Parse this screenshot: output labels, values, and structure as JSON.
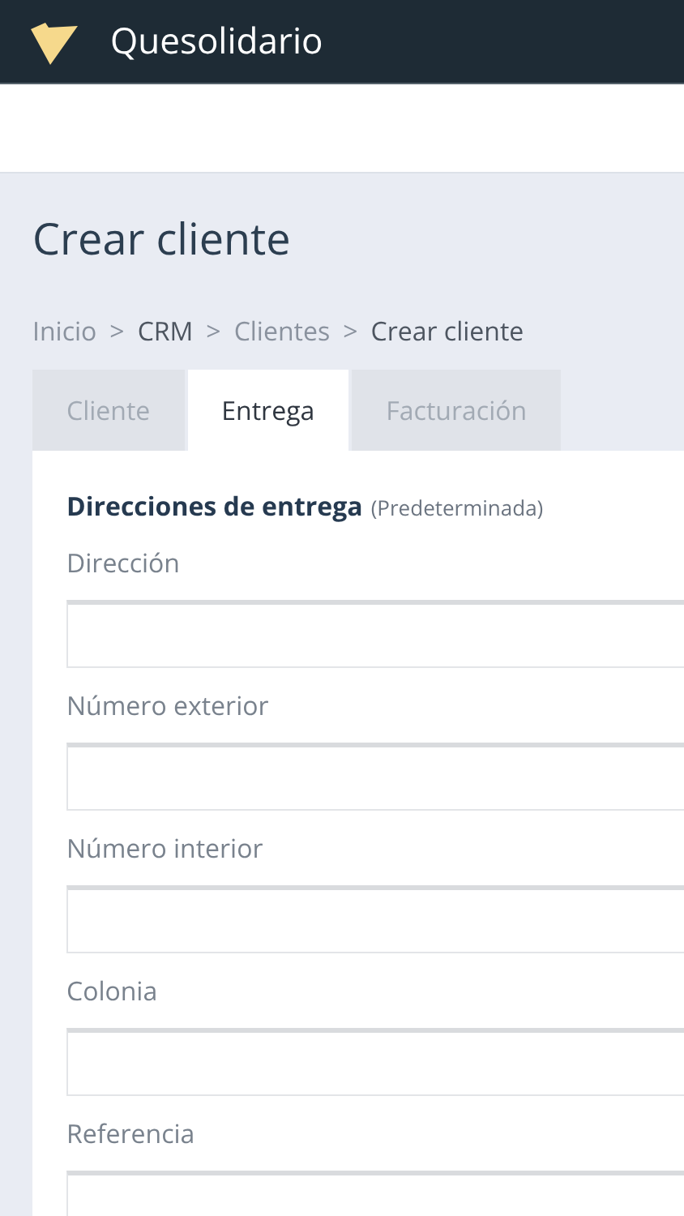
{
  "header": {
    "title": "Quesolidario"
  },
  "page_title": "Crear cliente",
  "breadcrumb": [
    {
      "label": "Inicio",
      "muted": true
    },
    {
      "label": ">",
      "muted": true
    },
    {
      "label": "CRM",
      "muted": false
    },
    {
      "label": ">",
      "muted": true
    },
    {
      "label": "Clientes",
      "muted": true
    },
    {
      "label": ">",
      "muted": true
    },
    {
      "label": "Crear cliente",
      "muted": false
    }
  ],
  "tabs": [
    {
      "label": "Cliente",
      "selected": false
    },
    {
      "label": "Entrega",
      "selected": true
    },
    {
      "label": "Facturación",
      "selected": false
    }
  ],
  "section": {
    "title": "Direcciones de entrega",
    "note": "(Predeterminada)"
  },
  "fields": [
    {
      "label": "Dirección"
    },
    {
      "label": "Número exterior"
    },
    {
      "label": "Número interior"
    },
    {
      "label": "Colonia"
    },
    {
      "label": "Referencia"
    }
  ]
}
